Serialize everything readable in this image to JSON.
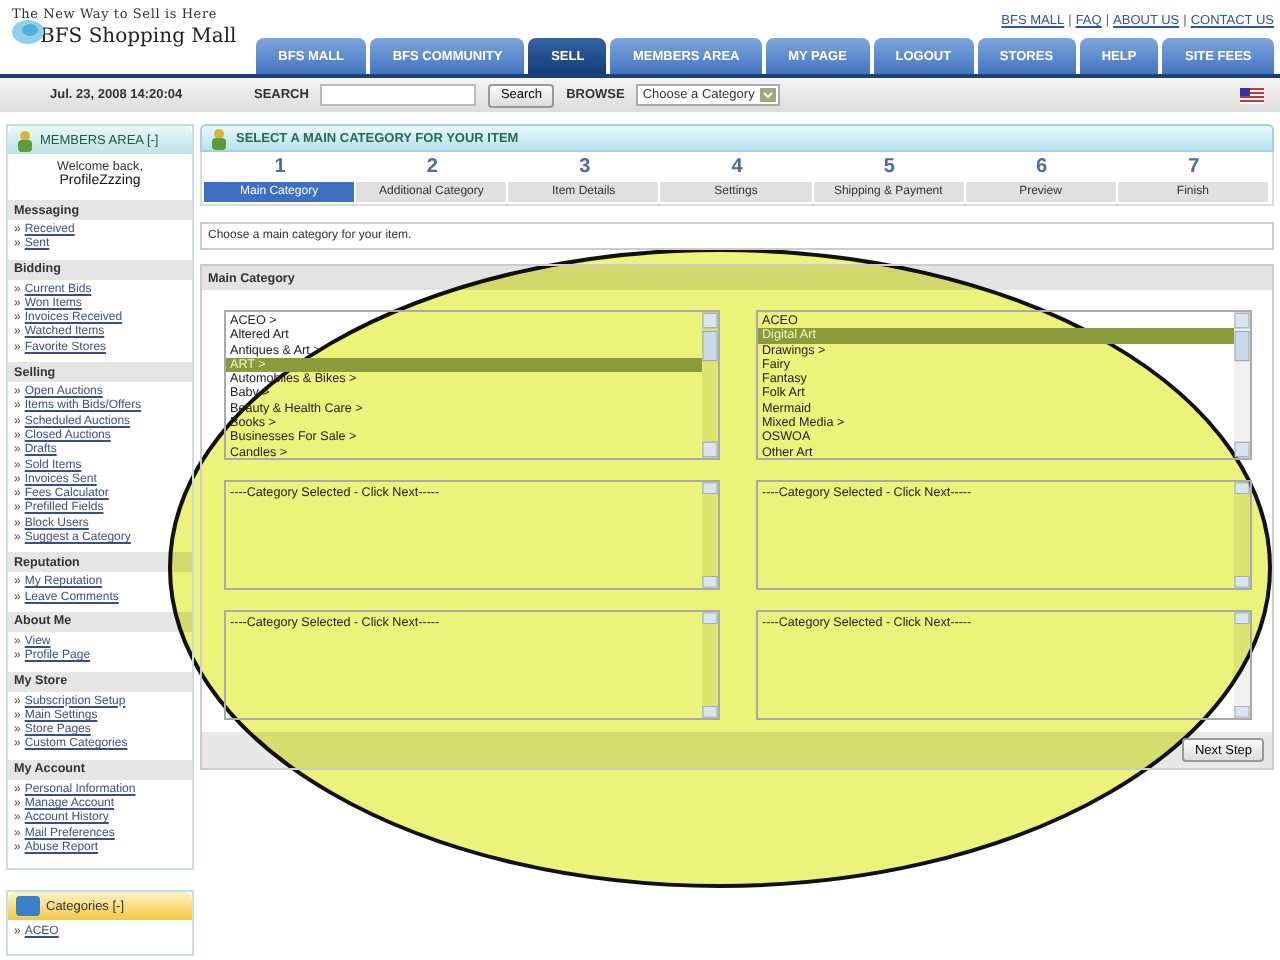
{
  "header": {
    "tagline": "The New Way to Sell is Here",
    "logo": "BFS Shopping Mall",
    "top_links": [
      "BFS MALL",
      "FAQ",
      "ABOUT US",
      "CONTACT US"
    ],
    "separator": "|",
    "tabs": [
      {
        "label": "BFS MALL",
        "selected": false
      },
      {
        "label": "BFS COMMUNITY",
        "selected": false
      },
      {
        "label": "SELL",
        "selected": true
      },
      {
        "label": "MEMBERS AREA",
        "selected": false
      },
      {
        "label": "MY PAGE",
        "selected": false
      },
      {
        "label": "LOGOUT",
        "selected": false
      },
      {
        "label": "STORES",
        "selected": false
      },
      {
        "label": "HELP",
        "selected": false
      },
      {
        "label": "SITE FEES",
        "selected": false
      }
    ]
  },
  "toolbar": {
    "date": "Jul. 23, 2008 14:20:04",
    "search_label": "SEARCH",
    "search_button": "Search",
    "browse_label": "BROWSE",
    "browse_value": "Choose a Category"
  },
  "sidebar": {
    "title": "MEMBERS AREA [-]",
    "welcome": "Welcome back,",
    "username": "ProfileZzzing",
    "sections": [
      {
        "title": "Messaging",
        "links": [
          [
            "»",
            "Received"
          ],
          [
            "»",
            "Sent"
          ]
        ]
      },
      {
        "title": "Bidding",
        "links": [
          [
            "»",
            "Current Bids"
          ],
          [
            "»",
            "Won Items"
          ],
          [
            "»",
            "Invoices Received"
          ],
          [
            "»",
            "Watched Items"
          ],
          [
            "»",
            "Favorite Stores"
          ]
        ]
      },
      {
        "title": "Selling",
        "links": [
          [
            "»",
            "Open Auctions"
          ],
          [
            "»",
            "Items with Bids/Offers"
          ],
          [
            "»",
            "Scheduled Auctions"
          ],
          [
            "»",
            "Closed Auctions"
          ],
          [
            "»",
            "Drafts"
          ],
          [
            "»",
            "Sold Items"
          ],
          [
            "»",
            "Invoices Sent"
          ],
          [
            "»",
            "Fees Calculator"
          ],
          [
            "»",
            "Prefilled Fields"
          ],
          [
            "»",
            "Block Users"
          ],
          [
            "»",
            "Suggest a Category"
          ]
        ]
      },
      {
        "title": "Reputation",
        "links": [
          [
            "»",
            "My Reputation"
          ],
          [
            "»",
            "Leave Comments"
          ]
        ]
      },
      {
        "title": "About Me",
        "links": [
          [
            "»",
            "View"
          ],
          [
            "»",
            "Profile Page"
          ]
        ]
      },
      {
        "title": "My Store",
        "links": [
          [
            "»",
            "Subscription Setup"
          ],
          [
            "»",
            "Main Settings"
          ],
          [
            "»",
            "Store Pages"
          ],
          [
            "»",
            "Custom Categories"
          ]
        ]
      },
      {
        "title": "My Account",
        "links": [
          [
            "»",
            "Personal Information"
          ],
          [
            "»",
            "Manage Account"
          ],
          [
            "»",
            "Account History"
          ],
          [
            "»",
            "Mail Preferences"
          ],
          [
            "»",
            "Abuse Report"
          ]
        ]
      }
    ],
    "categories_title": "Categories [-]",
    "categories_links": [
      [
        "»",
        "ACEO"
      ]
    ]
  },
  "main": {
    "title": "SELECT A MAIN CATEGORY FOR YOUR ITEM",
    "steps": [
      {
        "number": "1",
        "label": "Main Category",
        "selected": true
      },
      {
        "number": "2",
        "label": "Additional Category",
        "selected": false
      },
      {
        "number": "3",
        "label": "Item Details",
        "selected": false
      },
      {
        "number": "4",
        "label": "Settings",
        "selected": false
      },
      {
        "number": "5",
        "label": "Shipping & Payment",
        "selected": false
      },
      {
        "number": "6",
        "label": "Preview",
        "selected": false
      },
      {
        "number": "7",
        "label": "Finish",
        "selected": false
      }
    ],
    "instruction": "Choose a main category for your item.",
    "panel_title": "Main Category",
    "lists": [
      {
        "items": [
          {
            "label": "ACEO >",
            "selected": false
          },
          {
            "label": "Altered Art",
            "selected": false
          },
          {
            "label": "Antiques & Art >",
            "selected": false
          },
          {
            "label": "ART >",
            "selected": true
          },
          {
            "label": "Automobiles & Bikes >",
            "selected": false
          },
          {
            "label": "Baby >",
            "selected": false
          },
          {
            "label": "Beauty & Health Care >",
            "selected": false
          },
          {
            "label": "Books >",
            "selected": false
          },
          {
            "label": "Businesses For Sale >",
            "selected": false
          },
          {
            "label": "Candles >",
            "selected": false
          }
        ]
      },
      {
        "items": [
          {
            "label": "ACEO",
            "selected": false
          },
          {
            "label": "Digital Art",
            "selected": true
          },
          {
            "label": "Drawings >",
            "selected": false
          },
          {
            "label": "Fairy",
            "selected": false
          },
          {
            "label": "Fantasy",
            "selected": false
          },
          {
            "label": "Folk Art",
            "selected": false
          },
          {
            "label": "Mermaid",
            "selected": false
          },
          {
            "label": "Mixed Media >",
            "selected": false
          },
          {
            "label": "OSWOA",
            "selected": false
          },
          {
            "label": "Other Art",
            "selected": false
          }
        ]
      }
    ],
    "placeholder_boxes": [
      "----Category Selected - Click Next-----",
      "----Category Selected - Click Next-----",
      "----Category Selected - Click Next-----",
      "----Category Selected - Click Next-----"
    ],
    "next_button": "Next Step"
  },
  "annotation": {
    "kind": "ellipse"
  }
}
